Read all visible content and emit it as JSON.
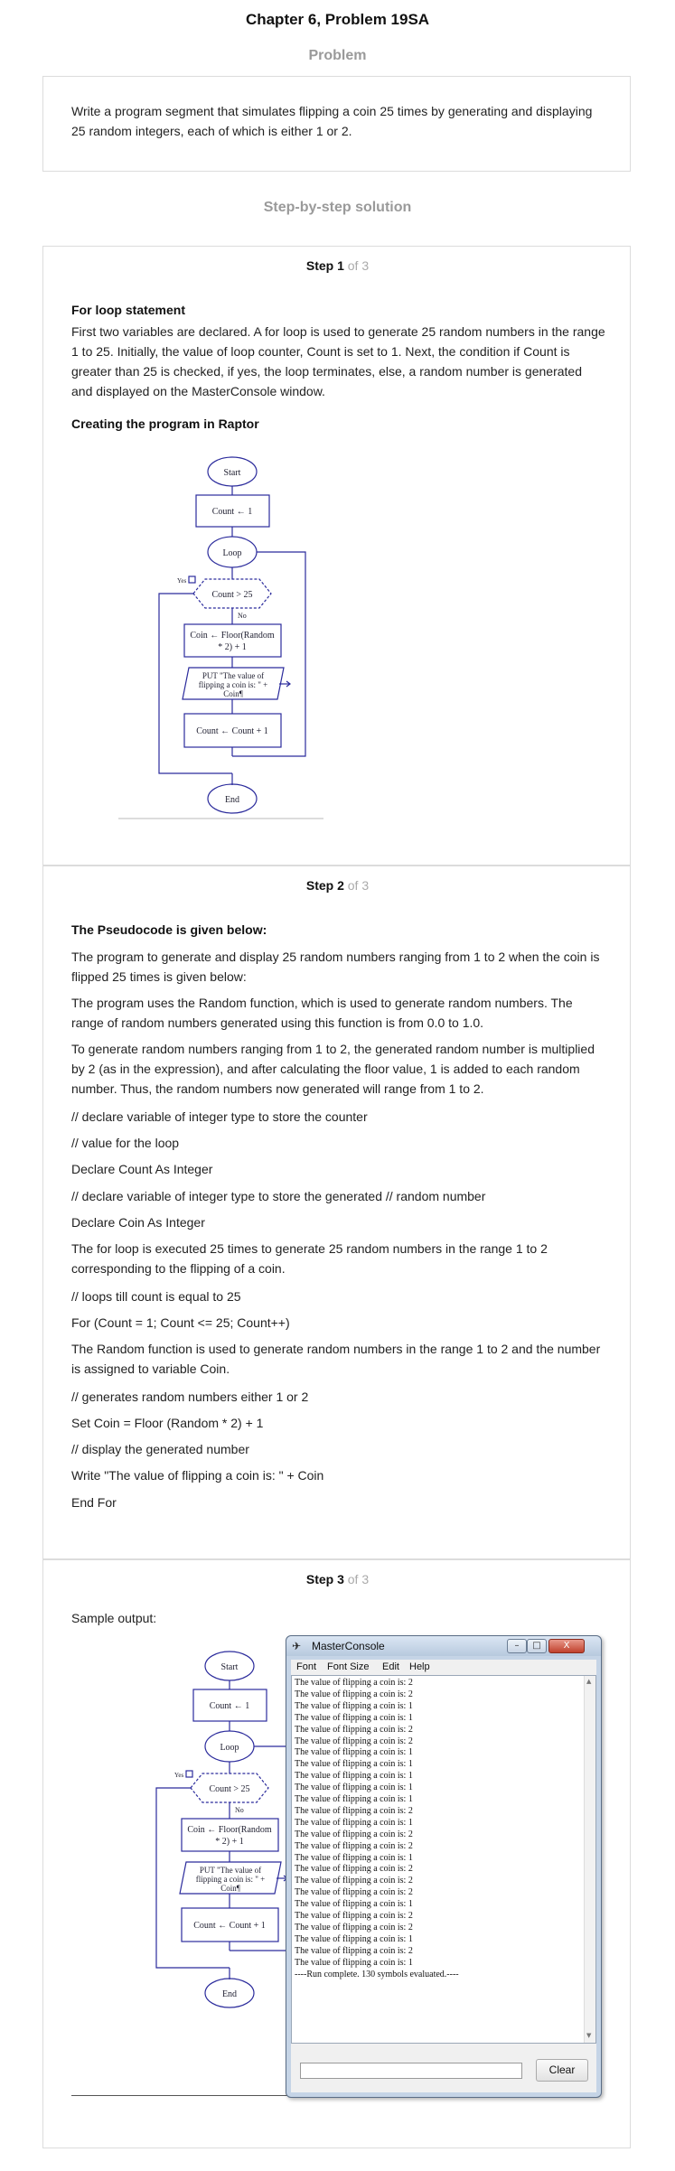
{
  "page": {
    "title": "Chapter 6, Problem 19SA",
    "problem_heading": "Problem",
    "solution_heading": "Step-by-step solution"
  },
  "problem": {
    "text": "Write a program segment that simulates flipping a coin 25 times by generating and displaying 25 random integers, each of which is either 1 or 2."
  },
  "steps": [
    {
      "num": "Step 1",
      "of": " of 3",
      "heading": "For loop statement",
      "para": "First two variables are declared. A for loop is used to generate 25 random numbers in the range 1 to 25. Initially, the value of loop counter, Count is set to 1. Next, the condition if Count is greater than 25 is checked, if yes, the loop terminates, else, a random number is generated and displayed on the MasterConsole window.",
      "subheading": "Creating the program in Raptor"
    },
    {
      "num": "Step 2",
      "of": " of 3",
      "heading": "The Pseudocode is given below:",
      "paras": [
        "The program to generate and display 25 random numbers ranging from 1 to 2 when the coin is flipped 25 times is given below:",
        "The program uses the Random function, which is used to generate random numbers. The range of random numbers generated using this function is from 0.0 to 1.0.",
        "To generate random numbers ranging from 1 to 2, the generated random number is multiplied by 2 (as in the expression), and after calculating the floor value, 1 is added to each random number. Thus, the random numbers now generated will range from 1 to 2."
      ],
      "lines": [
        "// declare variable of integer type to store the counter",
        "// value for the loop",
        "Declare Count As Integer",
        "// declare variable of integer type to store the generated // random number",
        "Declare Coin As Integer"
      ],
      "para4": "The for loop is executed 25 times to generate 25 random numbers in the range 1 to 2 corresponding to the flipping of a coin.",
      "lines2": [
        "// loops till count is equal to 25",
        "For (Count = 1; Count <= 25; Count++)"
      ],
      "para5": "The Random function is used to generate random numbers in the range 1 to 2 and the number is assigned to variable Coin.",
      "lines3": [
        "// generates random numbers either 1 or 2",
        "Set Coin = Floor (Random * 2) + 1",
        "// display the generated number",
        "Write \"The value of flipping a coin is: \" + Coin",
        "End For"
      ]
    },
    {
      "num": "Step 3",
      "of": " of 3",
      "label": "Sample output:"
    }
  ],
  "flowchart": {
    "start": "Start",
    "assign": "Count ← 1",
    "loop": "Loop",
    "yes": "Yes",
    "no": "No",
    "cond": "Count > 25",
    "coin1": "Coin ← Floor(Random",
    "coin2": "* 2) + 1",
    "put1": "PUT \"The value of",
    "put2": "flipping a coin is: \" +",
    "put3": "Coin¶",
    "inc": "Count ← Count + 1",
    "end": "End"
  },
  "console": {
    "title": "MasterConsole",
    "menu": [
      "Font",
      "Font Size",
      "Edit",
      "Help"
    ],
    "prefix": "The value of flipping a coin is: ",
    "values": [
      "2",
      "2",
      "1",
      "1",
      "2",
      "2",
      "1",
      "1",
      "1",
      "1",
      "1",
      "2",
      "1",
      "2",
      "2",
      "1",
      "2",
      "2",
      "2",
      "1",
      "2",
      "2",
      "1",
      "2",
      "1"
    ],
    "footer": "----Run complete.  130 symbols evaluated.----",
    "clear_label": "Clear",
    "btn_min": "–",
    "btn_max": "□",
    "btn_close": "X"
  }
}
